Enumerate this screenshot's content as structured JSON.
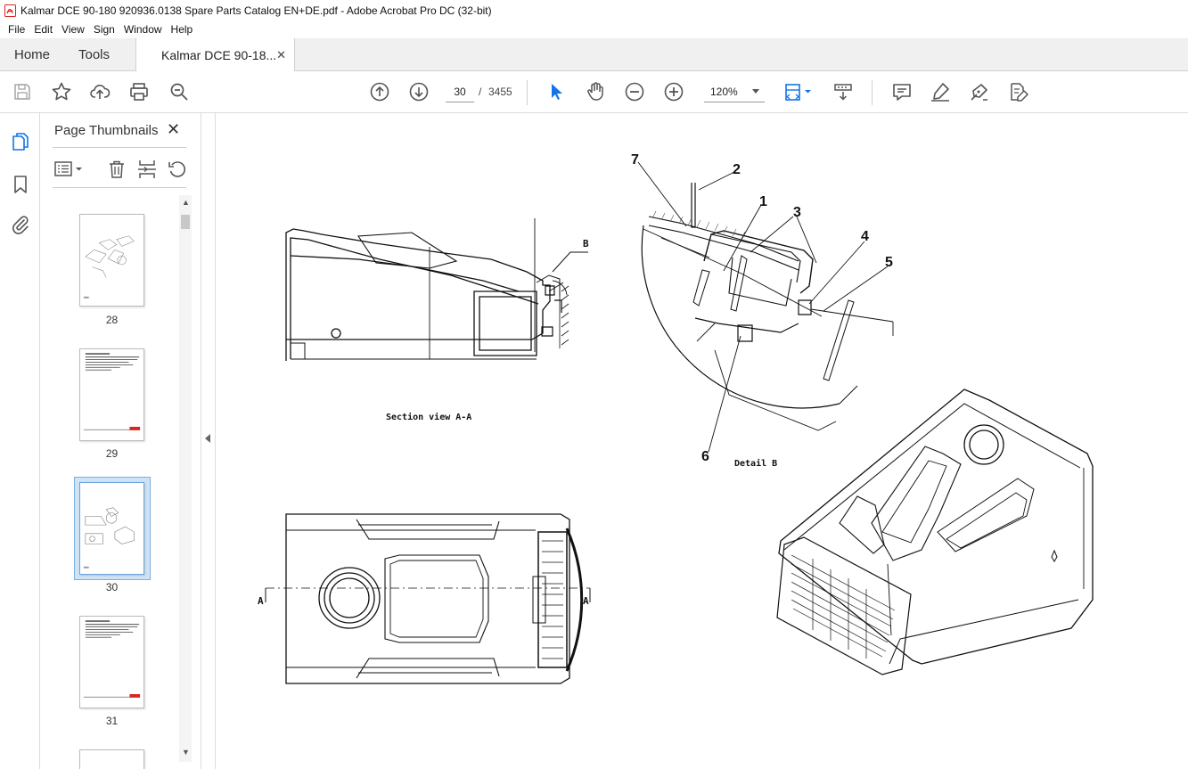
{
  "window": {
    "title": "Kalmar DCE 90-180 920936.0138 Spare Parts Catalog EN+DE.pdf - Adobe Acrobat Pro DC (32-bit)"
  },
  "menu": {
    "items": [
      "File",
      "Edit",
      "View",
      "Sign",
      "Window",
      "Help"
    ]
  },
  "tabs": {
    "home": "Home",
    "tools": "Tools",
    "document": "Kalmar DCE 90-18..."
  },
  "toolbar": {
    "current_page": "30",
    "page_separator": "/",
    "total_pages": "3455",
    "zoom": "120%"
  },
  "panel": {
    "title": "Page Thumbnails",
    "thumbnails": [
      {
        "label": "28"
      },
      {
        "label": "29"
      },
      {
        "label": "30",
        "selected": true
      },
      {
        "label": "31"
      }
    ]
  },
  "drawing": {
    "section_label": "Section view A-A",
    "detail_label": "Detail B",
    "view_marker_b": "B",
    "section_marker_a": "A",
    "callouts": [
      "7",
      "2",
      "1",
      "3",
      "4",
      "5",
      "6"
    ]
  },
  "colors": {
    "accent": "#1473e6",
    "pdf_red": "#d9251c",
    "selected_thumb": "#cfe3f5"
  }
}
